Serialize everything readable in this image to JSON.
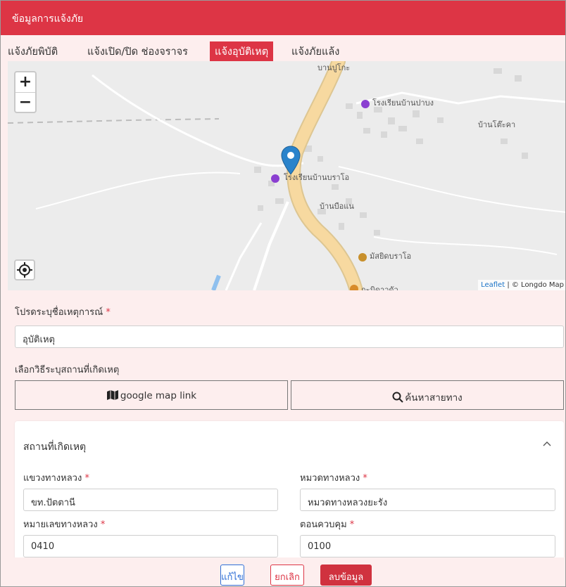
{
  "header": {
    "title": "ข้อมูลการแจ้งภัย",
    "background": "#dd3545"
  },
  "tabs": [
    {
      "label": "แจ้งภัยพิบัติ",
      "active": false
    },
    {
      "label": "แจ้งเปิด/ปิด ช่องจราจร",
      "active": false
    },
    {
      "label": "แจ้งอุบัติเหตุ",
      "active": true
    },
    {
      "label": "แจ้งภัยแล้ง",
      "active": false
    }
  ],
  "map": {
    "zoom_in": "+",
    "zoom_out": "−",
    "labels": {
      "village_top": "บานปูโกะ",
      "school_top": "โรงเรียนบ้านปาบง",
      "village_right": "บ้านโต๊ะคา",
      "school_mid": "โรงเรียนบ้านบราโอ",
      "village_mid": "บ้านบือแน",
      "mosque": "มัสยิดบราโอ",
      "bottom_cut": "กะมิดาวดัว"
    },
    "attribution_leaflet": "Leaflet",
    "attribution_rest": " | © Longdo Map"
  },
  "form": {
    "incident_name_label": "โปรดระบุชื่อเหตุการณ์",
    "incident_name_value": "อุบัติเหตุ",
    "method_label": "เลือกวิธีระบุสถานที่เกิดเหตุ",
    "google_map_button": "google map link",
    "search_route_button": "ค้นหาสายทาง",
    "location_section_title": "สถานที่เกิดเหตุ",
    "district_label": "แขวงทางหลวง",
    "district_value": "ขท.ปัตตานี",
    "unit_label": "หมวดทางหลวง",
    "unit_value": "หมวดทางหลวงยะรัง",
    "route_no_label": "หมายเลขทางหลวง",
    "route_no_value": "0410",
    "control_label": "ตอนควบคุม",
    "control_value": "0100",
    "required_mark": "*"
  },
  "footer": {
    "edit_label": "แก้ไข",
    "cancel_label": "ยกเลิก",
    "delete_label": "ลบข้อมูล"
  },
  "colors": {
    "accent": "#dd3545",
    "panel_bg": "#fdeeee",
    "edit_blue": "#2f6fd6",
    "marker_blue": "#2a83cb",
    "road": "#f5d99a"
  }
}
